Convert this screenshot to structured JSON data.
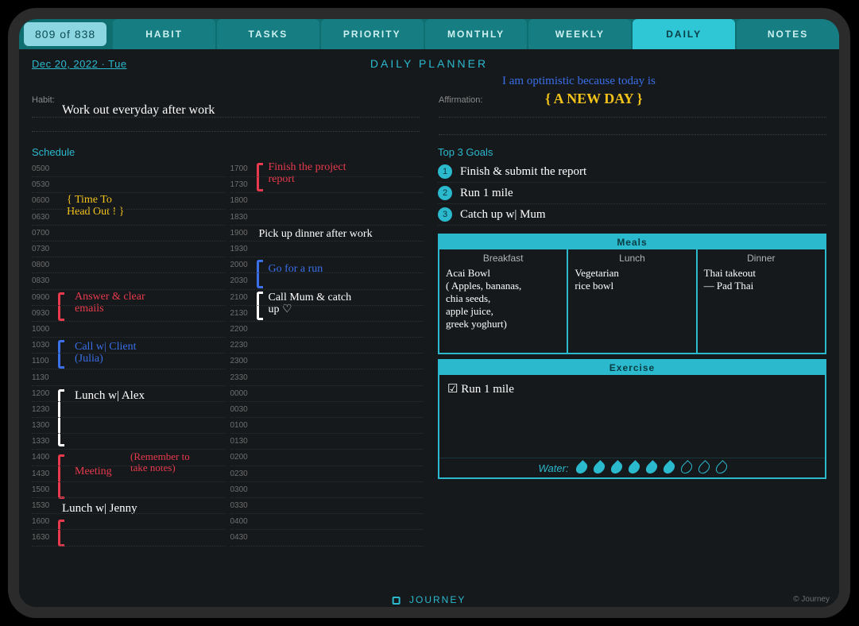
{
  "page_counter": "809 of 838",
  "tabs": {
    "habit": "HABIT",
    "tasks": "TASKS",
    "priority": "PRIORITY",
    "monthly": "MONTHLY",
    "weekly": "WEEKLY",
    "daily": "DAILY",
    "notes": "NOTES"
  },
  "date": "Dec 20, 2022 · Tue",
  "page_title": "DAILY PLANNER",
  "labels": {
    "habit": "Habit:",
    "affirmation": "Affirmation:",
    "schedule": "Schedule",
    "top3": "Top 3 Goals",
    "meals": "Meals",
    "breakfast": "Breakfast",
    "lunch": "Lunch",
    "dinner": "Dinner",
    "exercise": "Exercise",
    "water": "Water:"
  },
  "habit_text": "Work out everyday after work",
  "affirmation_line1": "I am optimistic because today is",
  "affirmation_line2": "{ A NEW DAY }",
  "schedule_left_times": [
    "0500",
    "0530",
    "0600",
    "0630",
    "0700",
    "0730",
    "0800",
    "0830",
    "0900",
    "0930",
    "1000",
    "1030",
    "1100",
    "1130",
    "1200",
    "1230",
    "1300",
    "1330",
    "1400",
    "1430",
    "1500",
    "1530",
    "1600",
    "1630"
  ],
  "schedule_right_times": [
    "1700",
    "1730",
    "1800",
    "1830",
    "1900",
    "1930",
    "2000",
    "2030",
    "2100",
    "2130",
    "2200",
    "2230",
    "2300",
    "2330",
    "0000",
    "0030",
    "0100",
    "0130",
    "0200",
    "0230",
    "0300",
    "0330",
    "0400",
    "0430"
  ],
  "entries": {
    "headout": "{ Time To\n   Head Out ! }",
    "emails": "Answer & clear\nemails",
    "client": "Call w| Client\n(Julia)",
    "lunch_alex": "Lunch w| Alex",
    "meeting": "Meeting",
    "meeting_note": "(Remember to\ntake notes)",
    "lunch_jenny": "Lunch w| Jenny",
    "project": "Finish the project\nreport",
    "dinner_pickup": "Pick up dinner after work",
    "run": "Go for a run",
    "call_mum": "Call Mum & catch\nup ♡"
  },
  "goals": [
    "Finish & submit the report",
    "Run 1 mile",
    "Catch up w| Mum"
  ],
  "meals": {
    "breakfast": "Acai Bowl\n( Apples, bananas,\nchia seeds,\napple juice,\ngreek yoghurt)",
    "lunch": "Vegetarian\nrice bowl",
    "dinner": "Thai takeout\n— Pad Thai"
  },
  "exercise": "☑ Run 1 mile",
  "water_filled": 6,
  "water_total": 9,
  "footer": "JOURNEY",
  "copyright": "© Journey"
}
